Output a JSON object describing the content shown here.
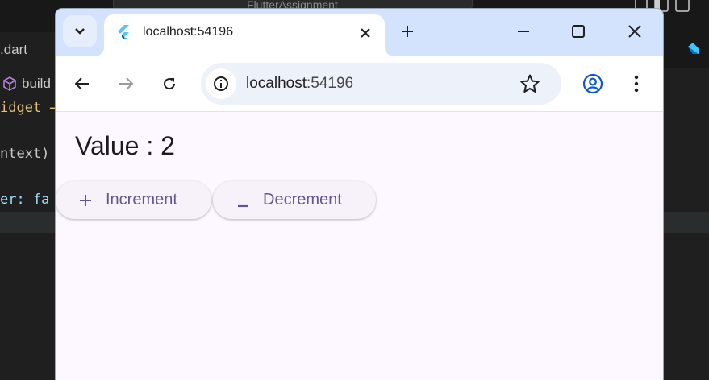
{
  "editor": {
    "search_text": "FlutterAssignment",
    "tab_label": ".dart",
    "breadcrumb": "build",
    "lines": [
      {
        "text": "idget →",
        "color": "#e5c07b"
      },
      {
        "text": "ntext)",
        "color": "#cccccc"
      },
      {
        "text": "er: fa",
        "color": "#cccccc"
      }
    ]
  },
  "browser": {
    "tab": {
      "title": "localhost:54196",
      "favicon": "flutter-logo"
    },
    "toolbar": {
      "url_host": "localhost",
      "url_port": ":54196"
    }
  },
  "app": {
    "value_label": "Value : 2",
    "buttons": [
      {
        "label": "Increment",
        "icon": "plus-icon"
      },
      {
        "label": "Decrement",
        "icon": "minus-icon"
      }
    ],
    "colors": {
      "background": "#fdf7ff",
      "button_background": "#f7f2fa",
      "button_text": "#65558f",
      "text": "#1d1b20"
    }
  }
}
